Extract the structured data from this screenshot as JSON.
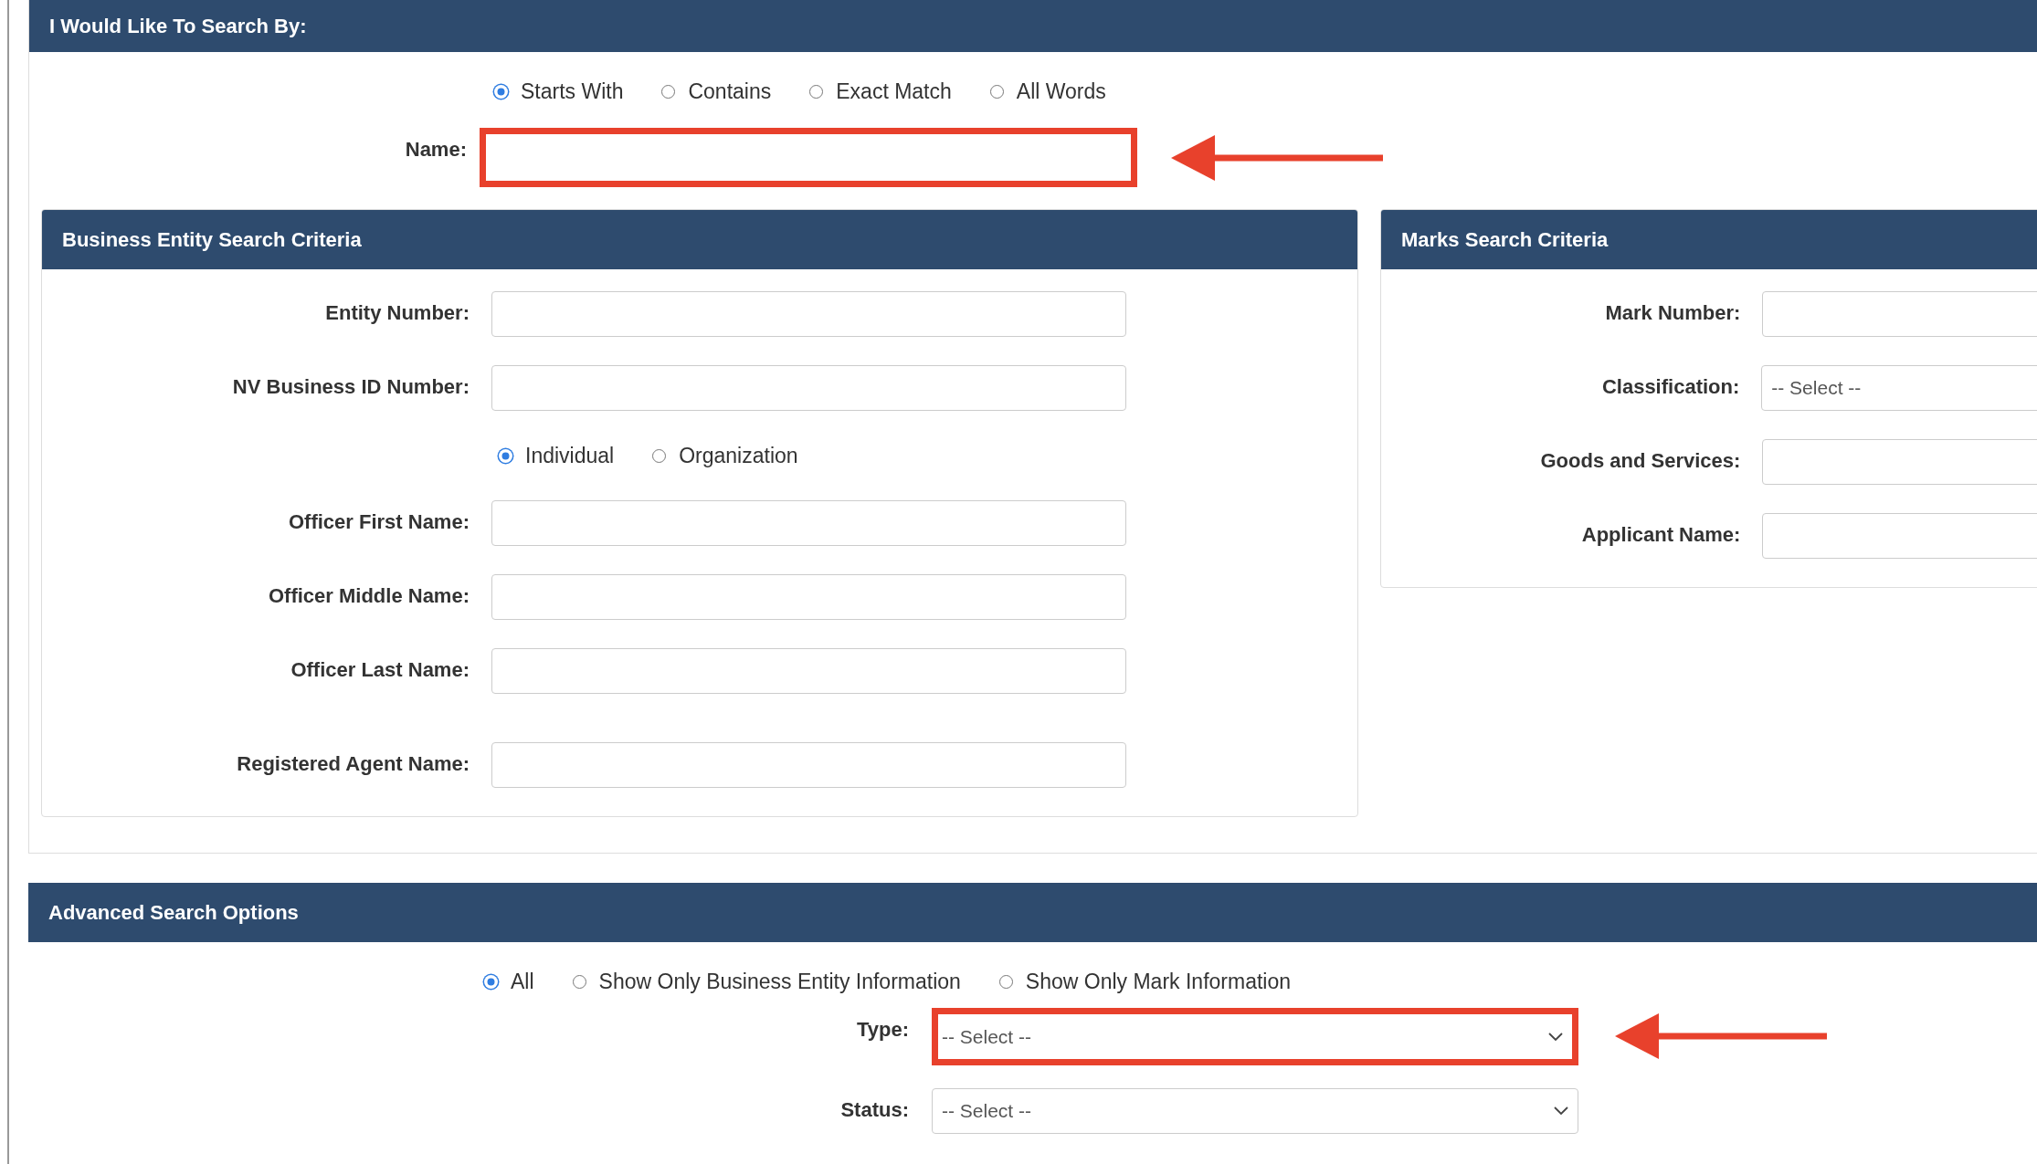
{
  "search_by": {
    "title": "I Would Like To Search By:",
    "match_options": [
      {
        "label": "Starts With",
        "selected": true
      },
      {
        "label": "Contains",
        "selected": false
      },
      {
        "label": "Exact Match",
        "selected": false
      },
      {
        "label": "All Words",
        "selected": false
      }
    ],
    "name_field": {
      "label": "Name:",
      "highlighted": true
    }
  },
  "business_entity": {
    "title": "Business Entity Search Criteria",
    "fields": [
      {
        "kind": "input",
        "label": "Entity Number:"
      },
      {
        "kind": "input",
        "label": "NV Business ID Number:"
      },
      {
        "kind": "radio",
        "options": [
          {
            "label": "Individual",
            "selected": true
          },
          {
            "label": "Organization",
            "selected": false
          }
        ]
      },
      {
        "kind": "input",
        "label": "Officer First Name:"
      },
      {
        "kind": "input",
        "label": "Officer Middle Name:"
      },
      {
        "kind": "input",
        "label": "Officer Last Name:"
      },
      {
        "kind": "input",
        "label": "Registered Agent Name:"
      }
    ]
  },
  "marks": {
    "title": "Marks Search Criteria",
    "fields": [
      {
        "kind": "input",
        "label": "Mark Number:"
      },
      {
        "kind": "select",
        "label": "Classification:",
        "value": "-- Select --"
      },
      {
        "kind": "input",
        "label": "Goods and Services:"
      },
      {
        "kind": "input",
        "label": "Applicant Name:"
      }
    ]
  },
  "advanced": {
    "title": "Advanced Search Options",
    "filter_options": [
      {
        "label": "All",
        "selected": true
      },
      {
        "label": "Show Only Business Entity Information",
        "selected": false
      },
      {
        "label": "Show Only Mark Information",
        "selected": false
      }
    ],
    "fields": [
      {
        "kind": "select",
        "label": "Type:",
        "value": "-- Select --",
        "highlighted": true
      },
      {
        "kind": "select",
        "label": "Status:",
        "value": "-- Select --",
        "highlighted": false
      }
    ]
  }
}
